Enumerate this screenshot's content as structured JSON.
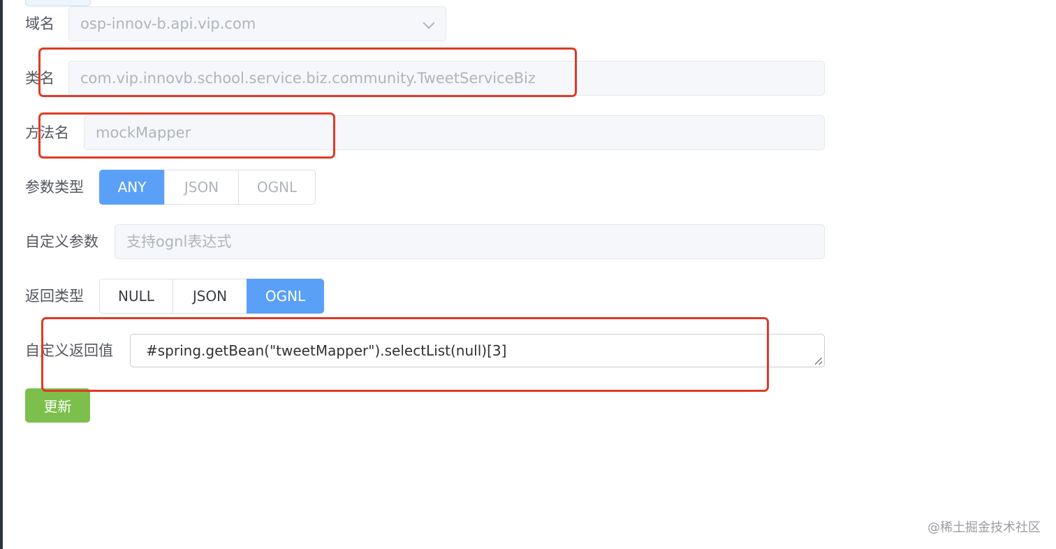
{
  "form": {
    "domain": {
      "label": "域名",
      "value": "osp-innov-b.api.vip.com"
    },
    "class_name": {
      "label": "类名",
      "value": "com.vip.innovb.school.service.biz.community.TweetServiceBiz"
    },
    "method_name": {
      "label": "方法名",
      "value": "mockMapper"
    },
    "param_type": {
      "label": "参数类型",
      "options": [
        "ANY",
        "JSON",
        "OGNL"
      ],
      "selected": "ANY"
    },
    "custom_param": {
      "label": "自定义参数",
      "placeholder": "支持ognl表达式"
    },
    "return_type": {
      "label": "返回类型",
      "options": [
        "NULL",
        "JSON",
        "OGNL"
      ],
      "selected": "OGNL"
    },
    "custom_return": {
      "label": "自定义返回值",
      "value": "#spring.getBean(\"tweetMapper\").selectList(null)[3]"
    },
    "update_button_label": "更新"
  },
  "watermark": "@稀土掘金技术社区",
  "colors": {
    "primary": "#5aa0f7",
    "success": "#7cc04b",
    "highlight": "#e03a24"
  }
}
